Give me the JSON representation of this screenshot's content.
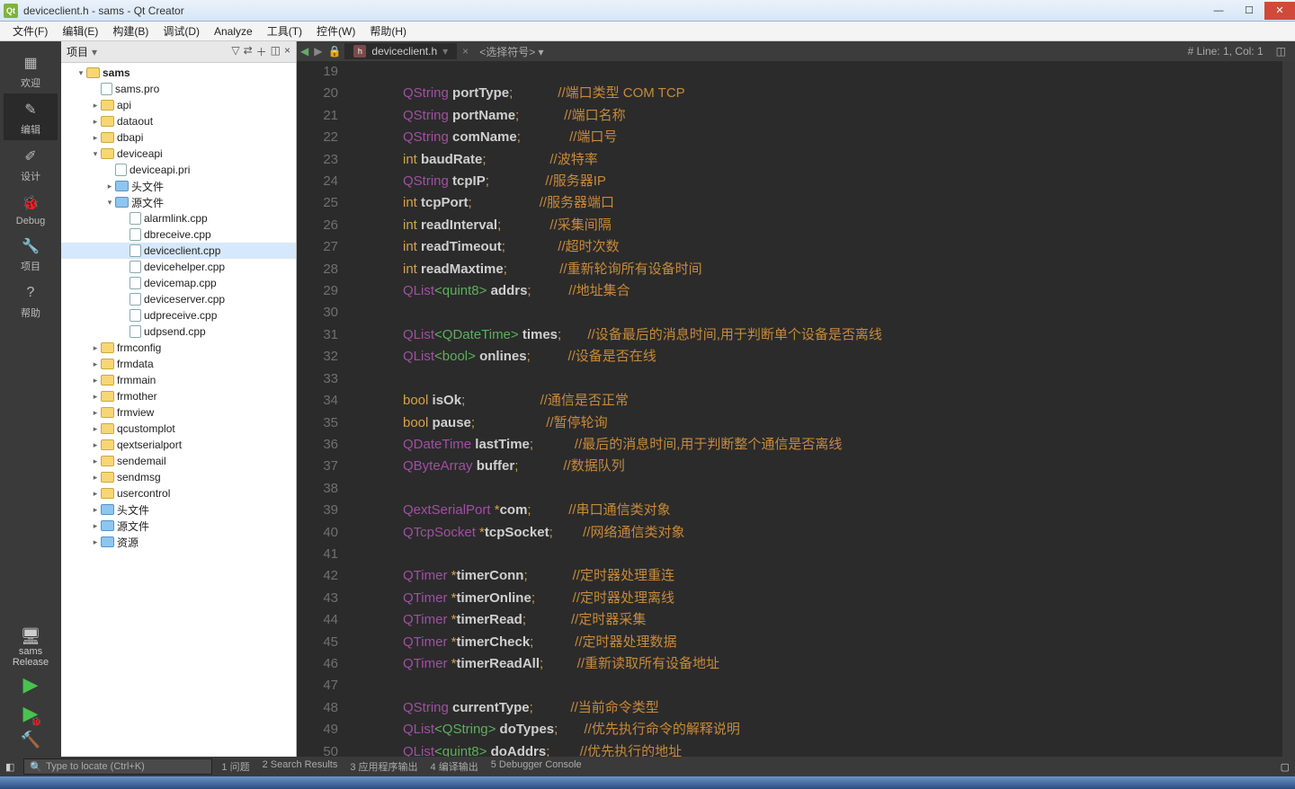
{
  "window": {
    "title": "deviceclient.h - sams - Qt Creator"
  },
  "menu": [
    "文件(F)",
    "编辑(E)",
    "构建(B)",
    "调试(D)",
    "Analyze",
    "工具(T)",
    "控件(W)",
    "帮助(H)"
  ],
  "mode": {
    "items": [
      {
        "icon": "▦",
        "label": "欢迎"
      },
      {
        "icon": "✎",
        "label": "编辑"
      },
      {
        "icon": "✐",
        "label": "设计"
      },
      {
        "icon": "🐞",
        "label": "Debug"
      },
      {
        "icon": "🔧",
        "label": "项目"
      },
      {
        "icon": "?",
        "label": "帮助"
      }
    ],
    "kit_name": "sams",
    "kit_mode": "Release"
  },
  "sidebar": {
    "title": "项目",
    "root": "sams",
    "nodes": [
      {
        "depth": 1,
        "exp": "▾",
        "fi": "proj",
        "label": "sams",
        "bold": true
      },
      {
        "depth": 2,
        "exp": "",
        "fi": "src",
        "label": "sams.pro"
      },
      {
        "depth": 2,
        "exp": "▸",
        "fi": "folder",
        "label": "api"
      },
      {
        "depth": 2,
        "exp": "▸",
        "fi": "folder",
        "label": "dataout"
      },
      {
        "depth": 2,
        "exp": "▸",
        "fi": "folder",
        "label": "dbapi"
      },
      {
        "depth": 2,
        "exp": "▾",
        "fi": "folder",
        "label": "deviceapi"
      },
      {
        "depth": 3,
        "exp": "",
        "fi": "src",
        "label": "deviceapi.pri"
      },
      {
        "depth": 3,
        "exp": "▸",
        "fi": "folder-blue",
        "label": "头文件"
      },
      {
        "depth": 3,
        "exp": "▾",
        "fi": "folder-blue",
        "label": "源文件"
      },
      {
        "depth": 4,
        "exp": "",
        "fi": "src",
        "label": "alarmlink.cpp"
      },
      {
        "depth": 4,
        "exp": "",
        "fi": "src",
        "label": "dbreceive.cpp"
      },
      {
        "depth": 4,
        "exp": "",
        "fi": "src",
        "label": "deviceclient.cpp",
        "sel": true
      },
      {
        "depth": 4,
        "exp": "",
        "fi": "src",
        "label": "devicehelper.cpp"
      },
      {
        "depth": 4,
        "exp": "",
        "fi": "src",
        "label": "devicemap.cpp"
      },
      {
        "depth": 4,
        "exp": "",
        "fi": "src",
        "label": "deviceserver.cpp"
      },
      {
        "depth": 4,
        "exp": "",
        "fi": "src",
        "label": "udpreceive.cpp"
      },
      {
        "depth": 4,
        "exp": "",
        "fi": "src",
        "label": "udpsend.cpp"
      },
      {
        "depth": 2,
        "exp": "▸",
        "fi": "folder",
        "label": "frmconfig"
      },
      {
        "depth": 2,
        "exp": "▸",
        "fi": "folder",
        "label": "frmdata"
      },
      {
        "depth": 2,
        "exp": "▸",
        "fi": "folder",
        "label": "frmmain"
      },
      {
        "depth": 2,
        "exp": "▸",
        "fi": "folder",
        "label": "frmother"
      },
      {
        "depth": 2,
        "exp": "▸",
        "fi": "folder",
        "label": "frmview"
      },
      {
        "depth": 2,
        "exp": "▸",
        "fi": "folder",
        "label": "qcustomplot"
      },
      {
        "depth": 2,
        "exp": "▸",
        "fi": "folder",
        "label": "qextserialport"
      },
      {
        "depth": 2,
        "exp": "▸",
        "fi": "folder",
        "label": "sendemail"
      },
      {
        "depth": 2,
        "exp": "▸",
        "fi": "folder",
        "label": "sendmsg"
      },
      {
        "depth": 2,
        "exp": "▸",
        "fi": "folder",
        "label": "usercontrol"
      },
      {
        "depth": 2,
        "exp": "▸",
        "fi": "folder-blue",
        "label": "头文件"
      },
      {
        "depth": 2,
        "exp": "▸",
        "fi": "folder-blue",
        "label": "源文件"
      },
      {
        "depth": 2,
        "exp": "▸",
        "fi": "folder-blue",
        "label": "资源"
      }
    ]
  },
  "editor": {
    "tab_name": "deviceclient.h",
    "symbol": "<选择符号>",
    "cursor": "# Line: 1, Col: 1",
    "first_line": 19,
    "lines": [
      [],
      [
        {
          "t": "ty",
          "s": "QString "
        },
        {
          "t": "id",
          "s": "portType"
        },
        {
          "t": "kw",
          "s": ";"
        },
        {
          "pad": 12
        },
        {
          "t": "cm",
          "s": "//端口类型 COM TCP"
        }
      ],
      [
        {
          "t": "ty",
          "s": "QString "
        },
        {
          "t": "id",
          "s": "portName"
        },
        {
          "t": "kw",
          "s": ";"
        },
        {
          "pad": 12
        },
        {
          "t": "cm",
          "s": "//端口名称"
        }
      ],
      [
        {
          "t": "ty",
          "s": "QString "
        },
        {
          "t": "id",
          "s": "comName"
        },
        {
          "t": "kw",
          "s": ";"
        },
        {
          "pad": 13
        },
        {
          "t": "cm",
          "s": "//端口号"
        }
      ],
      [
        {
          "t": "kw",
          "s": "int "
        },
        {
          "t": "id",
          "s": "baudRate"
        },
        {
          "t": "kw",
          "s": ";"
        },
        {
          "pad": 17
        },
        {
          "t": "cm",
          "s": "//波特率"
        }
      ],
      [
        {
          "t": "ty",
          "s": "QString "
        },
        {
          "t": "id",
          "s": "tcpIP"
        },
        {
          "t": "kw",
          "s": ";"
        },
        {
          "pad": 15
        },
        {
          "t": "cm",
          "s": "//服务器IP"
        }
      ],
      [
        {
          "t": "kw",
          "s": "int "
        },
        {
          "t": "id",
          "s": "tcpPort"
        },
        {
          "t": "kw",
          "s": ";"
        },
        {
          "pad": 18
        },
        {
          "t": "cm",
          "s": "//服务器端口"
        }
      ],
      [
        {
          "t": "kw",
          "s": "int "
        },
        {
          "t": "id",
          "s": "readInterval"
        },
        {
          "t": "kw",
          "s": ";"
        },
        {
          "pad": 13
        },
        {
          "t": "cm",
          "s": "//采集间隔"
        }
      ],
      [
        {
          "t": "kw",
          "s": "int "
        },
        {
          "t": "id",
          "s": "readTimeout"
        },
        {
          "t": "kw",
          "s": ";"
        },
        {
          "pad": 14
        },
        {
          "t": "cm",
          "s": "//超时次数"
        }
      ],
      [
        {
          "t": "kw",
          "s": "int "
        },
        {
          "t": "id",
          "s": "readMaxtime"
        },
        {
          "t": "kw",
          "s": ";"
        },
        {
          "pad": 14
        },
        {
          "t": "cm",
          "s": "//重新轮询所有设备时间"
        }
      ],
      [
        {
          "t": "ty",
          "s": "QList"
        },
        {
          "t": "tmpl",
          "s": "<quint8>"
        },
        {
          "t": "id",
          "s": " addrs"
        },
        {
          "t": "kw",
          "s": ";"
        },
        {
          "pad": 10
        },
        {
          "t": "cm",
          "s": "//地址集合"
        }
      ],
      [],
      [
        {
          "t": "ty",
          "s": "QList"
        },
        {
          "t": "tmpl",
          "s": "<QDateTime>"
        },
        {
          "t": "id",
          "s": " times"
        },
        {
          "t": "kw",
          "s": ";"
        },
        {
          "pad": 7
        },
        {
          "t": "cm",
          "s": "//设备最后的消息时间,用于判断单个设备是否离线"
        }
      ],
      [
        {
          "t": "ty",
          "s": "QList"
        },
        {
          "t": "tmpl",
          "s": "<bool>"
        },
        {
          "t": "id",
          "s": " onlines"
        },
        {
          "t": "kw",
          "s": ";"
        },
        {
          "pad": 10
        },
        {
          "t": "cm",
          "s": "//设备是否在线"
        }
      ],
      [],
      [
        {
          "t": "kw",
          "s": "bool "
        },
        {
          "t": "id",
          "s": "isOk"
        },
        {
          "t": "kw",
          "s": ";"
        },
        {
          "pad": 20
        },
        {
          "t": "cm",
          "s": "//通信是否正常"
        }
      ],
      [
        {
          "t": "kw",
          "s": "bool "
        },
        {
          "t": "id",
          "s": "pause"
        },
        {
          "t": "kw",
          "s": ";"
        },
        {
          "pad": 19
        },
        {
          "t": "cm",
          "s": "//暂停轮询"
        }
      ],
      [
        {
          "t": "ty",
          "s": "QDateTime "
        },
        {
          "t": "id",
          "s": "lastTime"
        },
        {
          "t": "kw",
          "s": ";"
        },
        {
          "pad": 11
        },
        {
          "t": "cm",
          "s": "//最后的消息时间,用于判断整个通信是否离线"
        }
      ],
      [
        {
          "t": "ty",
          "s": "QByteArray "
        },
        {
          "t": "id",
          "s": "buffer"
        },
        {
          "t": "kw",
          "s": ";"
        },
        {
          "pad": 12
        },
        {
          "t": "cm",
          "s": "//数据队列"
        }
      ],
      [],
      [
        {
          "t": "ty",
          "s": "QextSerialPort "
        },
        {
          "t": "kw",
          "s": "*"
        },
        {
          "t": "id",
          "s": "com"
        },
        {
          "t": "kw",
          "s": ";"
        },
        {
          "pad": 10
        },
        {
          "t": "cm",
          "s": "//串口通信类对象"
        }
      ],
      [
        {
          "t": "ty",
          "s": "QTcpSocket "
        },
        {
          "t": "kw",
          "s": "*"
        },
        {
          "t": "id",
          "s": "tcpSocket"
        },
        {
          "t": "kw",
          "s": ";"
        },
        {
          "pad": 8
        },
        {
          "t": "cm",
          "s": "//网络通信类对象"
        }
      ],
      [],
      [
        {
          "t": "ty",
          "s": "QTimer "
        },
        {
          "t": "kw",
          "s": "*"
        },
        {
          "t": "id",
          "s": "timerConn"
        },
        {
          "t": "kw",
          "s": ";"
        },
        {
          "pad": 12
        },
        {
          "t": "cm",
          "s": "//定时器处理重连"
        }
      ],
      [
        {
          "t": "ty",
          "s": "QTimer "
        },
        {
          "t": "kw",
          "s": "*"
        },
        {
          "t": "id",
          "s": "timerOnline"
        },
        {
          "t": "kw",
          "s": ";"
        },
        {
          "pad": 10
        },
        {
          "t": "cm",
          "s": "//定时器处理离线"
        }
      ],
      [
        {
          "t": "ty",
          "s": "QTimer "
        },
        {
          "t": "kw",
          "s": "*"
        },
        {
          "t": "id",
          "s": "timerRead"
        },
        {
          "t": "kw",
          "s": ";"
        },
        {
          "pad": 12
        },
        {
          "t": "cm",
          "s": "//定时器采集"
        }
      ],
      [
        {
          "t": "ty",
          "s": "QTimer "
        },
        {
          "t": "kw",
          "s": "*"
        },
        {
          "t": "id",
          "s": "timerCheck"
        },
        {
          "t": "kw",
          "s": ";"
        },
        {
          "pad": 11
        },
        {
          "t": "cm",
          "s": "//定时器处理数据"
        }
      ],
      [
        {
          "t": "ty",
          "s": "QTimer "
        },
        {
          "t": "kw",
          "s": "*"
        },
        {
          "t": "id",
          "s": "timerReadAll"
        },
        {
          "t": "kw",
          "s": ";"
        },
        {
          "pad": 9
        },
        {
          "t": "cm",
          "s": "//重新读取所有设备地址"
        }
      ],
      [],
      [
        {
          "t": "ty",
          "s": "QString "
        },
        {
          "t": "id",
          "s": "currentType"
        },
        {
          "t": "kw",
          "s": ";"
        },
        {
          "pad": 10
        },
        {
          "t": "cm",
          "s": "//当前命令类型"
        }
      ],
      [
        {
          "t": "ty",
          "s": "QList"
        },
        {
          "t": "tmpl",
          "s": "<QString>"
        },
        {
          "t": "id",
          "s": " doTypes"
        },
        {
          "t": "kw",
          "s": ";"
        },
        {
          "pad": 7
        },
        {
          "t": "cm",
          "s": "//优先执行命令的解释说明"
        }
      ],
      [
        {
          "t": "ty",
          "s": "QList"
        },
        {
          "t": "tmpl",
          "s": "<quint8>"
        },
        {
          "t": "id",
          "s": " doAddrs"
        },
        {
          "t": "kw",
          "s": ";"
        },
        {
          "pad": 8
        },
        {
          "t": "cm",
          "s": "//优先执行的地址"
        }
      ]
    ]
  },
  "locator": {
    "placeholder": "Type to locate (Ctrl+K)"
  },
  "output_panes": [
    "1 问题",
    "2 Search Results",
    "3 应用程序输出",
    "4 编译输出",
    "5 Debugger Console"
  ]
}
